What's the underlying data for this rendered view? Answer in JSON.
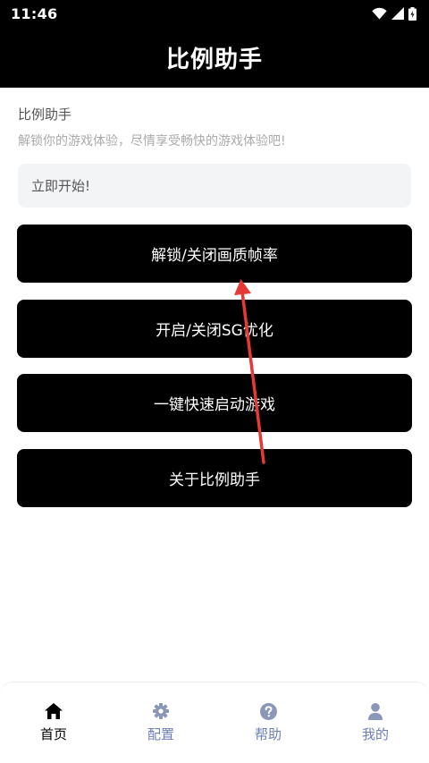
{
  "status_bar": {
    "time": "11:46"
  },
  "header": {
    "title": "比例助手"
  },
  "intro": {
    "title": "比例助手",
    "subtitle": "解锁你的游戏体验，尽情享受畅快的游戏体验吧!"
  },
  "notice": {
    "text": "立即开始!"
  },
  "actions": [
    {
      "label": "解锁/关闭画质帧率"
    },
    {
      "label": "开启/关闭SG优化"
    },
    {
      "label": "一键快速启动游戏"
    },
    {
      "label": "关于比例助手"
    }
  ],
  "tabbar": {
    "tabs": [
      {
        "label": "首页",
        "icon": "home-icon",
        "active": true
      },
      {
        "label": "配置",
        "icon": "gear-icon",
        "active": false
      },
      {
        "label": "帮助",
        "icon": "help-icon",
        "active": false
      },
      {
        "label": "我的",
        "icon": "user-icon",
        "active": false
      }
    ],
    "active_color": "#000000",
    "inactive_color": "#6b7fb5"
  },
  "colors": {
    "header_bg": "#000000",
    "button_bg": "#000000",
    "annotation_arrow": "#e53935"
  }
}
